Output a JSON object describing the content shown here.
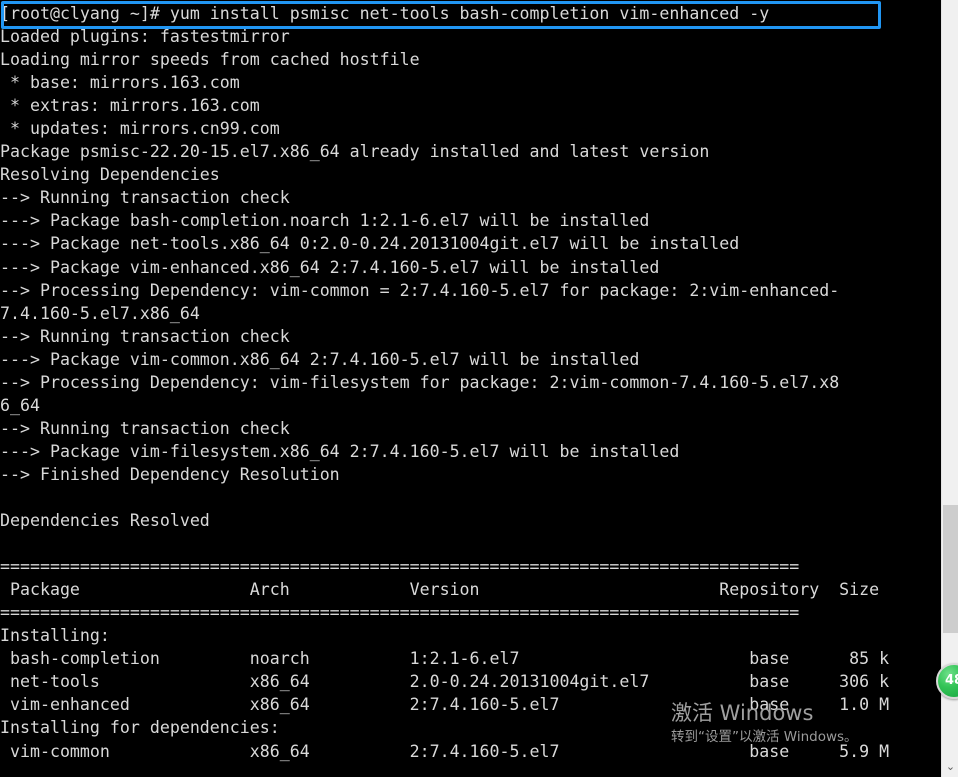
{
  "terminal": {
    "prompt": "[root@clyang ~]#",
    "command": "yum install psmisc net-tools bash-completion vim-enhanced -y",
    "command_line": "[root@clyang ~]# yum install psmisc net-tools bash-completion vim-enhanced -y",
    "lines": [
      "[root@clyang ~]# yum install psmisc net-tools bash-completion vim-enhanced -y",
      "Loaded plugins: fastestmirror",
      "Loading mirror speeds from cached hostfile",
      " * base: mirrors.163.com",
      " * extras: mirrors.163.com",
      " * updates: mirrors.cn99.com",
      "Package psmisc-22.20-15.el7.x86_64 already installed and latest version",
      "Resolving Dependencies",
      "--> Running transaction check",
      "---> Package bash-completion.noarch 1:2.1-6.el7 will be installed",
      "---> Package net-tools.x86_64 0:2.0-0.24.20131004git.el7 will be installed",
      "---> Package vim-enhanced.x86_64 2:7.4.160-5.el7 will be installed",
      "--> Processing Dependency: vim-common = 2:7.4.160-5.el7 for package: 2:vim-enhanced-",
      "7.4.160-5.el7.x86_64",
      "--> Running transaction check",
      "---> Package vim-common.x86_64 2:7.4.160-5.el7 will be installed",
      "--> Processing Dependency: vim-filesystem for package: 2:vim-common-7.4.160-5.el7.x8",
      "6_64",
      "--> Running transaction check",
      "---> Package vim-filesystem.x86_64 2:7.4.160-5.el7 will be installed",
      "--> Finished Dependency Resolution",
      "",
      "Dependencies Resolved",
      "",
      "================================================================================",
      " Package                 Arch            Version                        Repository  Size",
      "================================================================================",
      "Installing:",
      " bash-completion         noarch          1:2.1-6.el7                       base      85 k",
      " net-tools               x86_64          2.0-0.24.20131004git.el7          base     306 k",
      " vim-enhanced            x86_64          2:7.4.160-5.el7                   base     1.0 M",
      "Installing for dependencies:",
      " vim-common              x86_64          2:7.4.160-5.el7                   base     5.9 M"
    ],
    "separator": "================================================================================",
    "table": {
      "headers": [
        "Package",
        "Arch",
        "Version",
        "Repository",
        "Size"
      ],
      "section_installing": "Installing:",
      "section_dependencies": "Installing for dependencies:",
      "rows": [
        {
          "package": "bash-completion",
          "arch": "noarch",
          "version": "1:2.1-6.el7",
          "repository": "base",
          "size": "85 k"
        },
        {
          "package": "net-tools",
          "arch": "x86_64",
          "version": "2.0-0.24.20131004git.el7",
          "repository": "base",
          "size": "306 k"
        },
        {
          "package": "vim-enhanced",
          "arch": "x86_64",
          "version": "2:7.4.160-5.el7",
          "repository": "base",
          "size": "1.0 M"
        }
      ],
      "dependency_rows": [
        {
          "package": "vim-common",
          "arch": "x86_64",
          "version": "2:7.4.160-5.el7",
          "repository": "base",
          "size": "5.9 M"
        }
      ]
    },
    "colors": {
      "background": "#000000",
      "text": "#d9d9d9",
      "highlight_border": "#2196f3"
    }
  },
  "scrollbar": {
    "down_arrow_glyph": "⌄",
    "track_color": "#f0f0f0",
    "thumb_color": "#cdcdcd"
  },
  "badge": {
    "label": "48",
    "color": "#34c457"
  },
  "watermark": {
    "title": "激活 Windows",
    "subtitle": "转到“设置”以激活 Windows。"
  }
}
